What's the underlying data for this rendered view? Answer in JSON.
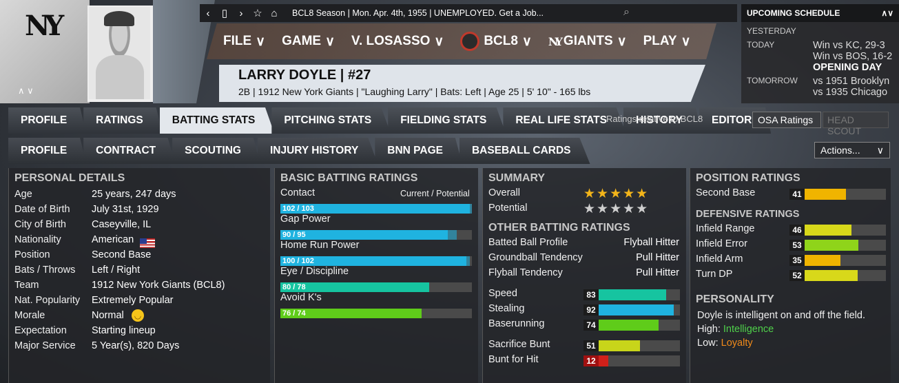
{
  "team_logo": "NY",
  "header": {
    "icons": [
      "back-icon",
      "tablet-icon",
      "forward-icon",
      "star-icon",
      "home-icon"
    ],
    "status": "BCL8 Season  |  Mon. Apr. 4th, 1955  |  UNEMPLOYED. Get a Job..."
  },
  "menu": [
    "FILE",
    "GAME",
    "V. LOSASSO",
    "BCL8",
    "GIANTS",
    "PLAY"
  ],
  "player": {
    "name": "LARRY DOYLE  |  #27",
    "details": "2B | 1912 New York Giants  |  \"Laughing Larry\" | Bats: Left  |  Age 25  |  5' 10\" - 165 lbs"
  },
  "schedule": {
    "title": "UPCOMING SCHEDULE",
    "rows": [
      {
        "label": "YESTERDAY",
        "value": ""
      },
      {
        "label": "TODAY",
        "value": "Win vs KC, 29-3"
      },
      {
        "label": "",
        "value": "Win vs BOS, 16-2"
      },
      {
        "label": "",
        "value": "OPENING DAY"
      },
      {
        "label": "TOMORROW",
        "value": "vs 1951 Brooklyn"
      },
      {
        "label": "",
        "value": "vs 1935 Chicago"
      }
    ]
  },
  "tabs1": [
    "PROFILE",
    "RATINGS",
    "BATTING STATS",
    "PITCHING STATS",
    "FIELDING STATS",
    "REAL LIFE STATS",
    "HISTORY",
    "EDITOR"
  ],
  "tabs2": [
    "PROFILE",
    "CONTRACT",
    "SCOUTING",
    "INJURY HISTORY",
    "BNN PAGE",
    "BASEBALL CARDS"
  ],
  "ratings_relative": "Ratings relative to BCL8",
  "osa": "OSA Ratings",
  "head_scout": "HEAD SCOUT",
  "actions": "Actions...",
  "personal": {
    "title": "PERSONAL DETAILS",
    "rows": [
      [
        "Age",
        "25 years, 247 days"
      ],
      [
        "Date of Birth",
        "July 31st, 1929"
      ],
      [
        "City of Birth",
        "Caseyville, IL"
      ],
      [
        "Nationality",
        "American"
      ],
      [
        "Position",
        "Second Base"
      ],
      [
        "Bats / Throws",
        "Left / Right"
      ],
      [
        "Team",
        "1912 New York Giants (BCL8)"
      ],
      [
        "Nat. Popularity",
        "Extremely Popular"
      ],
      [
        "Morale",
        "Normal"
      ],
      [
        "Expectation",
        "Starting lineup"
      ],
      [
        "Major Service",
        "5 Year(s), 820 Days"
      ]
    ]
  },
  "batting": {
    "title": "BASIC BATTING RATINGS",
    "legend": "Current / Potential",
    "rows": [
      {
        "label": "Contact",
        "text": "102 / 103",
        "cur": 102,
        "pot": 103,
        "color": "#1fb3e0"
      },
      {
        "label": "Gap Power",
        "text": "90 / 95",
        "cur": 90,
        "pot": 95,
        "color": "#1fb3e0"
      },
      {
        "label": "Home Run Power",
        "text": "100 / 102",
        "cur": 100,
        "pot": 102,
        "color": "#1fb3e0"
      },
      {
        "label": "Eye / Discipline",
        "text": "80 / 78",
        "cur": 80,
        "pot": 78,
        "color": "#16c4a0"
      },
      {
        "label": "Avoid K's",
        "text": "76 / 74",
        "cur": 76,
        "pot": 74,
        "color": "#5fcc1a"
      }
    ]
  },
  "summary": {
    "title": "SUMMARY",
    "overall_label": "Overall",
    "overall_stars": "★★★★★",
    "potential_label": "Potential",
    "potential_stars": "★★★★★",
    "other_title": "OTHER BATTING RATINGS",
    "other": [
      [
        "Batted Ball Profile",
        "Flyball Hitter"
      ],
      [
        "Groundball Tendency",
        "Pull Hitter"
      ],
      [
        "Flyball Tendency",
        "Pull Hitter"
      ]
    ],
    "speed": [
      {
        "label": "Speed",
        "v": 83,
        "color": "#16c4a0"
      },
      {
        "label": "Stealing",
        "v": 92,
        "color": "#1fb3e0"
      },
      {
        "label": "Baserunning",
        "v": 74,
        "color": "#5fcc1a"
      },
      {
        "label": "Sacrifice Bunt",
        "v": 51,
        "color": "#c8d51a"
      },
      {
        "label": "Bunt for Hit",
        "v": 12,
        "color": "#d0201a"
      }
    ]
  },
  "position": {
    "title": "POSITION RATINGS",
    "rows": [
      {
        "label": "Second Base",
        "v": 41,
        "color": "#f0b400"
      }
    ],
    "def_title": "DEFENSIVE RATINGS",
    "def": [
      {
        "label": "Infield Range",
        "v": 46,
        "color": "#d8d81a"
      },
      {
        "label": "Infield Error",
        "v": 53,
        "color": "#8fd41a"
      },
      {
        "label": "Infield Arm",
        "v": 35,
        "color": "#f0b400"
      },
      {
        "label": "Turn DP",
        "v": 52,
        "color": "#d8d81a"
      }
    ],
    "pers_title": "PERSONALITY",
    "pers_text": "Doyle is intelligent on and off the field.",
    "high_label": "High:",
    "high": "Intelligence",
    "low_label": "Low:",
    "low": "Loyalty"
  }
}
